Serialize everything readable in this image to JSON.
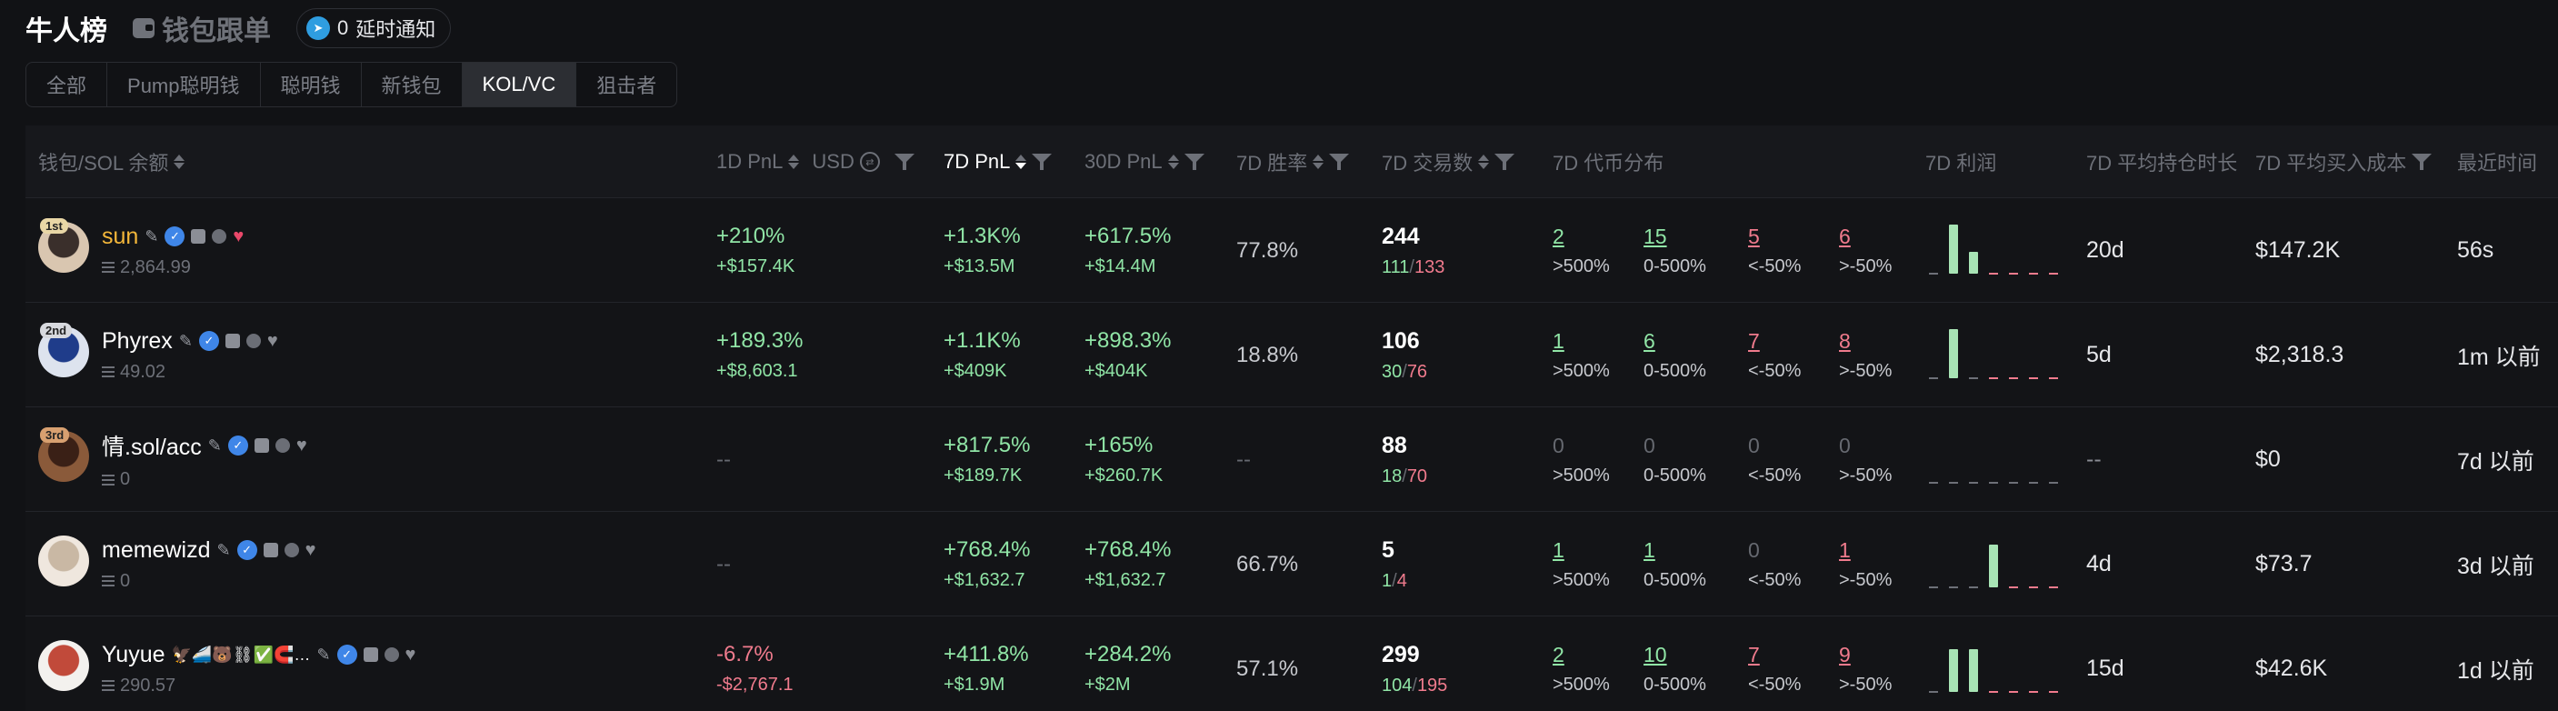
{
  "header": {
    "title": "牛人榜",
    "wallet_follow": "钱包跟单",
    "notify_count": "0",
    "notify_label": "延时通知"
  },
  "tabs": [
    "全部",
    "Pump聪明钱",
    "聪明钱",
    "新钱包",
    "KOL/VC",
    "狙击者"
  ],
  "active_tab": "KOL/VC",
  "columns": {
    "wallet": "钱包/SOL 余额",
    "pnl_1d": "1D PnL",
    "usd": "USD",
    "pnl_7d": "7D PnL",
    "pnl_30d": "30D PnL",
    "winrate_7d": "7D 胜率",
    "trades_7d": "7D 交易数",
    "dist_7d": "7D 代币分布",
    "profit_7d": "7D 利润",
    "hold_7d": "7D 平均持仓时长",
    "cost_7d": "7D 平均买入成本",
    "recent": "最近时间"
  },
  "dist_labels": [
    ">500%",
    "0-500%",
    "<-50%",
    ">-50%"
  ],
  "rows": [
    {
      "rank": "1st",
      "name": "sun",
      "name_color": "#f4b73a",
      "liked": true,
      "emojis": "",
      "balance": "2,864.99",
      "pnl_1d_pct": "+210%",
      "pnl_1d_usd": "+$157.4K",
      "pnl_1d_sign": "pos",
      "pnl_7d_pct": "+1.3K%",
      "pnl_7d_usd": "+$13.5M",
      "pnl_30d_pct": "+617.5%",
      "pnl_30d_usd": "+$14.4M",
      "winrate": "77.8%",
      "trades_total": "244",
      "trades_buy": "111",
      "trades_sell": "133",
      "dist": [
        "2",
        "15",
        "5",
        "6"
      ],
      "profit_bars": [
        0,
        0.72,
        0.32,
        0,
        0,
        0,
        0
      ],
      "hold": "20d",
      "cost": "$147.2K",
      "recent": "56s"
    },
    {
      "rank": "2nd",
      "name": "Phyrex",
      "name_color": "#ffffff",
      "liked": false,
      "emojis": "",
      "balance": "49.02",
      "pnl_1d_pct": "+189.3%",
      "pnl_1d_usd": "+$8,603.1",
      "pnl_1d_sign": "pos",
      "pnl_7d_pct": "+1.1K%",
      "pnl_7d_usd": "+$409K",
      "pnl_30d_pct": "+898.3%",
      "pnl_30d_usd": "+$404K",
      "winrate": "18.8%",
      "trades_total": "106",
      "trades_buy": "30",
      "trades_sell": "76",
      "dist": [
        "1",
        "6",
        "7",
        "8"
      ],
      "profit_bars": [
        0,
        0.72,
        0,
        0,
        0,
        0,
        0
      ],
      "hold": "5d",
      "cost": "$2,318.3",
      "recent": "1m 以前"
    },
    {
      "rank": "3rd",
      "name": "情.sol/acc",
      "name_color": "#ffffff",
      "liked": false,
      "emojis": "",
      "balance": "0",
      "pnl_1d_pct": "--",
      "pnl_1d_usd": "",
      "pnl_1d_sign": "none",
      "pnl_7d_pct": "+817.5%",
      "pnl_7d_usd": "+$189.7K",
      "pnl_30d_pct": "+165%",
      "pnl_30d_usd": "+$260.7K",
      "winrate": "--",
      "trades_total": "88",
      "trades_buy": "18",
      "trades_sell": "70",
      "dist": [
        "0",
        "0",
        "0",
        "0"
      ],
      "profit_bars": [
        0,
        0,
        0,
        0,
        0,
        0,
        0
      ],
      "hold": "--",
      "cost": "$0",
      "recent": "7d 以前"
    },
    {
      "rank": "",
      "name": "memewizd",
      "name_color": "#ffffff",
      "liked": false,
      "emojis": "",
      "balance": "0",
      "pnl_1d_pct": "--",
      "pnl_1d_usd": "",
      "pnl_1d_sign": "none",
      "pnl_7d_pct": "+768.4%",
      "pnl_7d_usd": "+$1,632.7",
      "pnl_30d_pct": "+768.4%",
      "pnl_30d_usd": "+$1,632.7",
      "winrate": "66.7%",
      "trades_total": "5",
      "trades_buy": "1",
      "trades_sell": "4",
      "dist": [
        "1",
        "1",
        "0",
        "1"
      ],
      "profit_bars": [
        0,
        0,
        0,
        0.62,
        0,
        0,
        0
      ],
      "hold": "4d",
      "cost": "$73.7",
      "recent": "3d 以前"
    },
    {
      "rank": "",
      "name": "Yuyue",
      "name_color": "#ffffff",
      "liked": false,
      "emojis": "🦅🚄🐻⛓✅🧲…",
      "balance": "290.57",
      "pnl_1d_pct": "-6.7%",
      "pnl_1d_usd": "-$2,767.1",
      "pnl_1d_sign": "neg",
      "pnl_7d_pct": "+411.8%",
      "pnl_7d_usd": "+$1.9M",
      "pnl_30d_pct": "+284.2%",
      "pnl_30d_usd": "+$2M",
      "winrate": "57.1%",
      "trades_total": "299",
      "trades_buy": "104",
      "trades_sell": "195",
      "dist": [
        "2",
        "10",
        "7",
        "9"
      ],
      "profit_bars": [
        0,
        0.62,
        0.62,
        0,
        0,
        0,
        0
      ],
      "hold": "15d",
      "cost": "$42.6K",
      "recent": "1d 以前"
    }
  ]
}
